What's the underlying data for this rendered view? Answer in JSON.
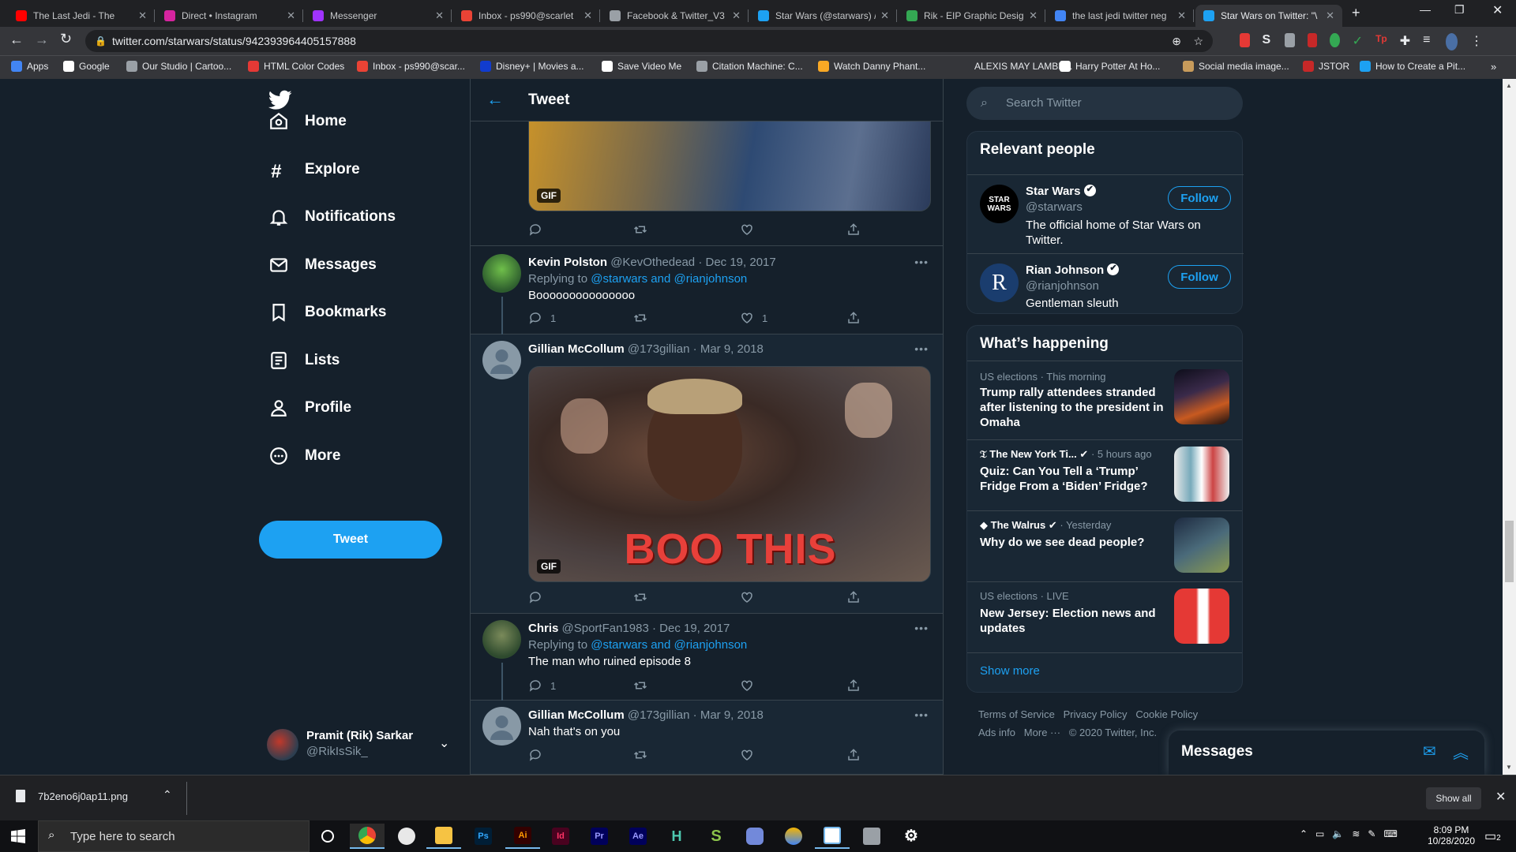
{
  "browser": {
    "tabs": [
      {
        "title": "The Last Jedi - The",
        "color": "#ff0000"
      },
      {
        "title": "Direct • Instagram",
        "color": "#d6249f"
      },
      {
        "title": "Messenger",
        "color": "#a033ff"
      },
      {
        "title": "Inbox - ps990@scarlet",
        "color": "#ea4335"
      },
      {
        "title": "Facebook & Twitter_V3",
        "color": "#9aa0a6"
      },
      {
        "title": "Star Wars (@starwars) /",
        "color": "#1da1f2"
      },
      {
        "title": "Rik - EIP Graphic Desig",
        "color": "#34a853"
      },
      {
        "title": "the last jedi twitter neg",
        "color": "#4285f4"
      },
      {
        "title": "Star Wars on Twitter: \"\\",
        "color": "#1da1f2"
      }
    ],
    "url": "twitter.com/starwars/status/942393964405157888",
    "bookmarks": [
      {
        "label": "Apps",
        "color": "#4285f4"
      },
      {
        "label": "Google",
        "color": "#ffffff"
      },
      {
        "label": "Our Studio | Cartoo...",
        "color": "#9aa0a6"
      },
      {
        "label": "HTML Color Codes",
        "color": "#e53935"
      },
      {
        "label": "Inbox - ps990@scar...",
        "color": "#ea4335"
      },
      {
        "label": "Disney+ | Movies a...",
        "color": "#113ccf"
      },
      {
        "label": "Save Video Me",
        "color": "#ffffff"
      },
      {
        "label": "Citation Machine: C...",
        "color": "#9aa0a6"
      },
      {
        "label": "Watch Danny Phant...",
        "color": "#f9a825"
      },
      {
        "label": "ALEXIS MAY LAMBE...",
        "color": "#35363a"
      },
      {
        "label": "Harry Potter At Ho...",
        "color": "#ffffff"
      },
      {
        "label": "Social media image...",
        "color": "#c79b5b"
      },
      {
        "label": "JSTOR",
        "color": "#c62828"
      },
      {
        "label": "How to Create a Pit...",
        "color": "#1da1f2"
      }
    ]
  },
  "nav": {
    "items": [
      "Home",
      "Explore",
      "Notifications",
      "Messages",
      "Bookmarks",
      "Lists",
      "Profile",
      "More"
    ],
    "tweet_button": "Tweet",
    "account": {
      "name": "Pramit (Rik) Sarkar",
      "handle": "@RikIsSik_"
    }
  },
  "header": {
    "title": "Tweet"
  },
  "tweets": [
    {
      "name": "Kevin Polston",
      "handle": "@KevOthedead",
      "date": "· Dec 19, 2017",
      "replying": "Replying to",
      "mentions": "@starwars and @rianjohnson",
      "text": "Booooooooooooooo",
      "replies": "1",
      "likes": "1"
    },
    {
      "name": "Gillian McCollum",
      "handle": "@173gillian",
      "date": "· Mar 9, 2018",
      "gif_caption": "BOO THIS",
      "gif_label": "GIF"
    },
    {
      "name": "Chris",
      "handle": "@SportFan1983",
      "date": "· Dec 19, 2017",
      "replying": "Replying to",
      "mentions": "@starwars and @rianjohnson",
      "text": "The man who ruined episode 8",
      "replies": "1"
    },
    {
      "name": "Gillian McCollum",
      "handle": "@173gillian",
      "date": "· Mar 9, 2018",
      "text": "Nah that's on you"
    }
  ],
  "top_gif_label": "GIF",
  "right": {
    "search_placeholder": "Search Twitter",
    "relevant": {
      "title": "Relevant people",
      "people": [
        {
          "name": "Star Wars",
          "handle": "@starwars",
          "bio": "The official home of Star Wars on Twitter.",
          "follow": "Follow",
          "avatar_text": "STAR WARS"
        },
        {
          "name": "Rian Johnson",
          "handle": "@rianjohnson",
          "bio": "Gentleman sleuth",
          "follow": "Follow",
          "avatar_text": "R"
        }
      ]
    },
    "happening": {
      "title": "What’s happening",
      "trends": [
        {
          "meta": "US elections · This morning",
          "headline": "Trump rally attendees stranded after listening to the president in Omaha"
        },
        {
          "source": "The New York Ti...",
          "meta": "· 5 hours ago",
          "headline": "Quiz: Can You Tell a ‘Trump’ Fridge From a ‘Biden’ Fridge?"
        },
        {
          "source": "The Walrus",
          "meta": "· Yesterday",
          "headline": "Why do we see dead people?"
        },
        {
          "meta": "US elections · LIVE",
          "headline": "New Jersey: Election news and updates"
        }
      ],
      "show_more": "Show more"
    },
    "footer": {
      "line1": "Terms of Service   Privacy Policy   Cookie Policy",
      "line2": "Ads info   More ···   © 2020 Twitter, Inc."
    },
    "messages": "Messages"
  },
  "download": {
    "file": "7b2eno6j0ap11.png",
    "show_all": "Show all"
  },
  "taskbar": {
    "search": "Type here to search",
    "time": "8:09 PM",
    "date": "10/28/2020",
    "notif": "2"
  }
}
